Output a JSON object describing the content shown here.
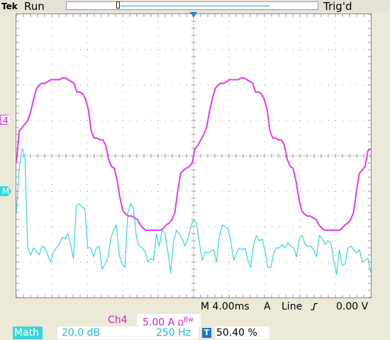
{
  "status_bar": {
    "brand": "Tek",
    "run_state": "Run",
    "trigger_status": "Trig'd"
  },
  "channels": {
    "ch4": {
      "marker": "4",
      "label": "Ch4",
      "scale": "5.00 A",
      "ohm_symbol": "Ω",
      "bw_symbol": "Bw",
      "color": "#e33ce6"
    },
    "math": {
      "marker": "M",
      "label": "Math",
      "scale_db": "20.0 dB",
      "scale_hz": "250 Hz",
      "color": "#38d6dc"
    }
  },
  "horizontal": {
    "timebase": "M 4.00ms",
    "position": "50.40 %",
    "cursor_icon": "T"
  },
  "trigger": {
    "source": "A",
    "coupling": "Line",
    "slope_icon": "rising-edge-icon",
    "level": "0.00 V"
  },
  "chart_data": {
    "type": "line",
    "grid": true,
    "divisions": {
      "x": 10,
      "y": 8
    },
    "series": [
      {
        "trace": "ch4",
        "color": "#e33ce6",
        "y": [
          -0.2,
          0.7,
          0.8,
          0.9,
          1.0,
          1.25,
          1.6,
          1.9,
          2.0,
          2.05,
          2.05,
          2.1,
          2.15,
          2.15,
          2.15,
          2.15,
          2.2,
          2.2,
          2.15,
          2.1,
          2.05,
          1.8,
          1.8,
          1.75,
          1.6,
          1.3,
          0.7,
          0.5,
          0.5,
          0.45,
          0.45,
          0.3,
          -0.1,
          -0.3,
          -0.35,
          -0.7,
          -1.2,
          -1.55,
          -1.65,
          -1.7,
          -1.7,
          -1.75,
          -1.8,
          -1.95,
          -2.05,
          -2.1,
          -2.1,
          -2.1,
          -2.1,
          -2.1,
          -2.1,
          -2.05,
          -1.95,
          -1.9,
          -1.8,
          -1.6,
          -1.0,
          -0.5,
          -0.4,
          -0.35,
          -0.3,
          -0.2,
          0.2,
          0.3,
          0.45,
          0.6,
          0.8,
          1.25,
          1.6,
          1.9,
          2.0,
          2.05,
          2.05,
          2.1,
          2.15,
          2.15,
          2.15,
          2.15,
          2.2,
          2.2,
          2.15,
          2.1,
          2.05,
          1.8,
          1.8,
          1.75,
          1.6,
          1.3,
          0.7,
          0.5,
          0.5,
          0.45,
          0.45,
          0.3,
          -0.1,
          -0.3,
          -0.35,
          -0.7,
          -1.2,
          -1.55,
          -1.65,
          -1.7,
          -1.7,
          -1.75,
          -1.8,
          -1.95,
          -2.05,
          -2.1,
          -2.1,
          -2.1,
          -2.1,
          -2.1,
          -2.1,
          -2.05,
          -1.95,
          -1.9,
          -1.8,
          -1.6,
          -1.0,
          -0.5,
          -0.4,
          -0.3,
          0.15,
          0.2
        ]
      },
      {
        "trace": "math",
        "color": "#38d6dc",
        "y": [
          -1.6,
          -0.4,
          0.2,
          0.0,
          -2.6,
          -2.8,
          -2.6,
          -2.7,
          -2.8,
          -2.55,
          -2.6,
          -2.8,
          -3.0,
          -2.7,
          -2.6,
          -2.5,
          -2.3,
          -2.35,
          -2.2,
          -2.5,
          -2.9,
          -1.4,
          -1.35,
          -1.45,
          -1.5,
          -2.6,
          -2.6,
          -2.85,
          -2.6,
          -2.55,
          -3.2,
          -3.05,
          -2.9,
          -2.35,
          -2.1,
          -1.95,
          -2.8,
          -3.05,
          -3.15,
          -1.6,
          -1.35,
          -1.5,
          -2.3,
          -2.55,
          -2.6,
          -2.7,
          -3.0,
          -2.9,
          -2.95,
          -2.2,
          -2.55,
          -2.1,
          -2.2,
          -2.7,
          -3.3,
          -2.4,
          -2.1,
          -2.2,
          -2.35,
          -2.55,
          -2.35,
          -2.0,
          -1.8,
          -1.9,
          -2.45,
          -2.95,
          -2.7,
          -2.75,
          -2.7,
          -2.65,
          -3.0,
          -2.3,
          -1.95,
          -2.0,
          -2.05,
          -2.4,
          -2.95,
          -2.75,
          -2.6,
          -2.65,
          -2.6,
          -2.95,
          -3.15,
          -2.5,
          -2.25,
          -2.4,
          -2.35,
          -2.7,
          -3.15,
          -3.15,
          -2.75,
          -2.6,
          -2.6,
          -2.5,
          -2.6,
          -2.45,
          -2.55,
          -2.6,
          -2.85,
          -2.3,
          -2.25,
          -2.5,
          -2.55,
          -2.55,
          -2.65,
          -2.85,
          -2.25,
          -2.35,
          -2.5,
          -2.4,
          -2.45,
          -2.95,
          -3.35,
          -2.65,
          -3.1,
          -3.05,
          -2.6,
          -2.55,
          -2.65,
          -2.75,
          -2.65,
          -3.0,
          -2.95,
          -2.9,
          -3.3
        ]
      }
    ]
  }
}
